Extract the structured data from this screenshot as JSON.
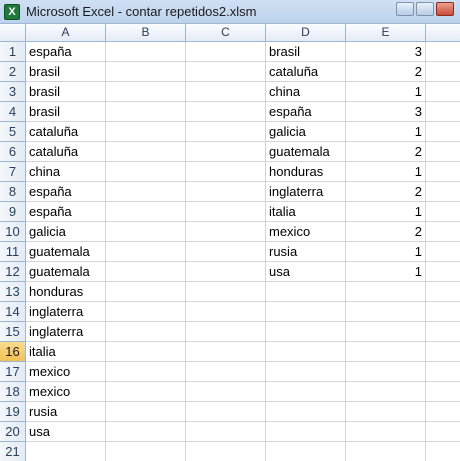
{
  "window": {
    "title": "Microsoft Excel - contar repetidos2.xlsm",
    "app_icon_glyph": "X"
  },
  "sheet": {
    "columns": [
      "A",
      "B",
      "C",
      "D",
      "E"
    ],
    "rows": [
      "1",
      "2",
      "3",
      "4",
      "5",
      "6",
      "7",
      "8",
      "9",
      "10",
      "11",
      "12",
      "13",
      "14",
      "15",
      "16",
      "17",
      "18",
      "19",
      "20",
      "21"
    ],
    "selected_row": "16",
    "col_a": [
      "españa",
      "brasil",
      "brasil",
      "brasil",
      "cataluña",
      "cataluña",
      "china",
      "españa",
      "españa",
      "galicia",
      "guatemala",
      "guatemala",
      "honduras",
      "inglaterra",
      "inglaterra",
      "italia",
      "mexico",
      "mexico",
      "rusia",
      "usa"
    ],
    "col_d": [
      "brasil",
      "cataluña",
      "china",
      "españa",
      "galicia",
      "guatemala",
      "honduras",
      "inglaterra",
      "italia",
      "mexico",
      "rusia",
      "usa"
    ],
    "col_e": [
      "3",
      "2",
      "1",
      "3",
      "1",
      "2",
      "1",
      "2",
      "1",
      "2",
      "1",
      "1"
    ]
  },
  "colors": {
    "title_bar": "#bcd3ee",
    "header_bg": "#e5ecf6",
    "selected_row_header": "#f3c154",
    "gridline": "#d4d4d4"
  }
}
